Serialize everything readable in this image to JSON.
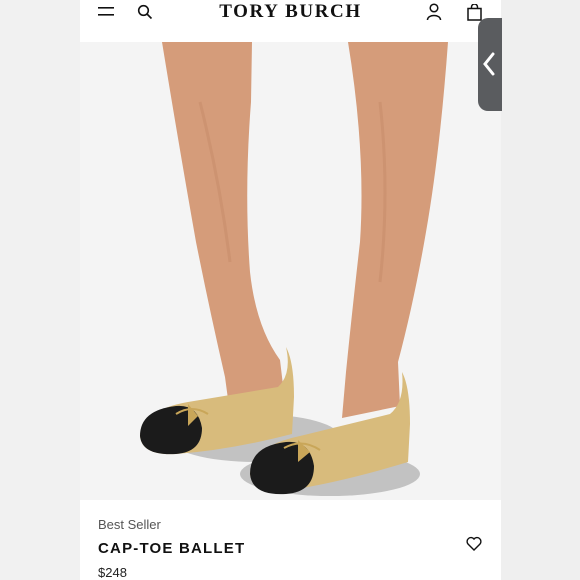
{
  "header": {
    "logo": "TORY BURCH",
    "icons": [
      "menu-icon",
      "search-icon",
      "account-icon",
      "bag-icon"
    ]
  },
  "product": {
    "badge": "Best Seller",
    "name": "CAP-TOE BALLET",
    "price": "$248"
  },
  "colors": {
    "shoe_tan": "#d7b97a",
    "cap_black": "#1a1a1a",
    "skin": "#d49b78",
    "background": "#f4f4f4"
  }
}
